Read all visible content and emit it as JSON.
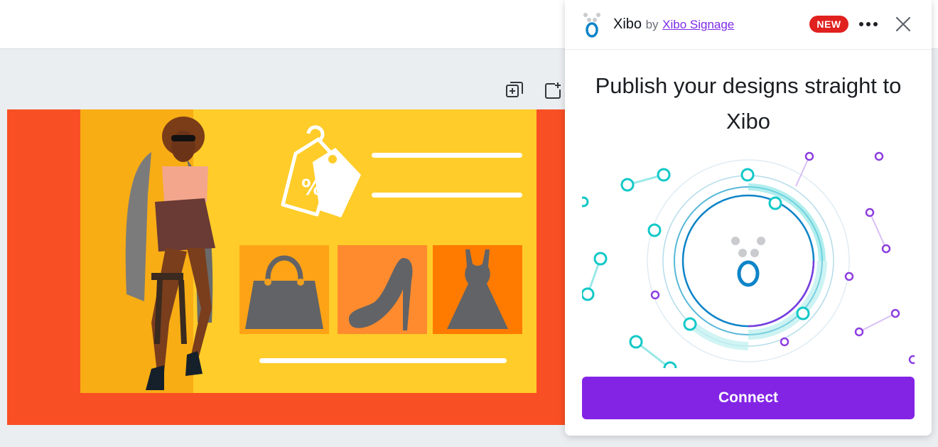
{
  "app": {
    "name": "Xibo",
    "by": "by",
    "author": "Xibo Signage",
    "badge": "NEW"
  },
  "panel": {
    "title": "Publish your designs straight to Xibo",
    "connect_label": "Connect"
  },
  "icons": {
    "duplicate_page": "duplicate-page-icon",
    "add_page": "add-page-icon",
    "more": "more-options-icon",
    "close": "close-icon",
    "logo": "xibo-logo-icon"
  },
  "colors": {
    "brand_purple": "#8324e5",
    "badge_red": "#e0211e",
    "canvas_orange": "#f94f24",
    "card_yellow": "#ffcc29",
    "xibo_blue": "#0e84c8",
    "teal": "#13c8c8"
  }
}
